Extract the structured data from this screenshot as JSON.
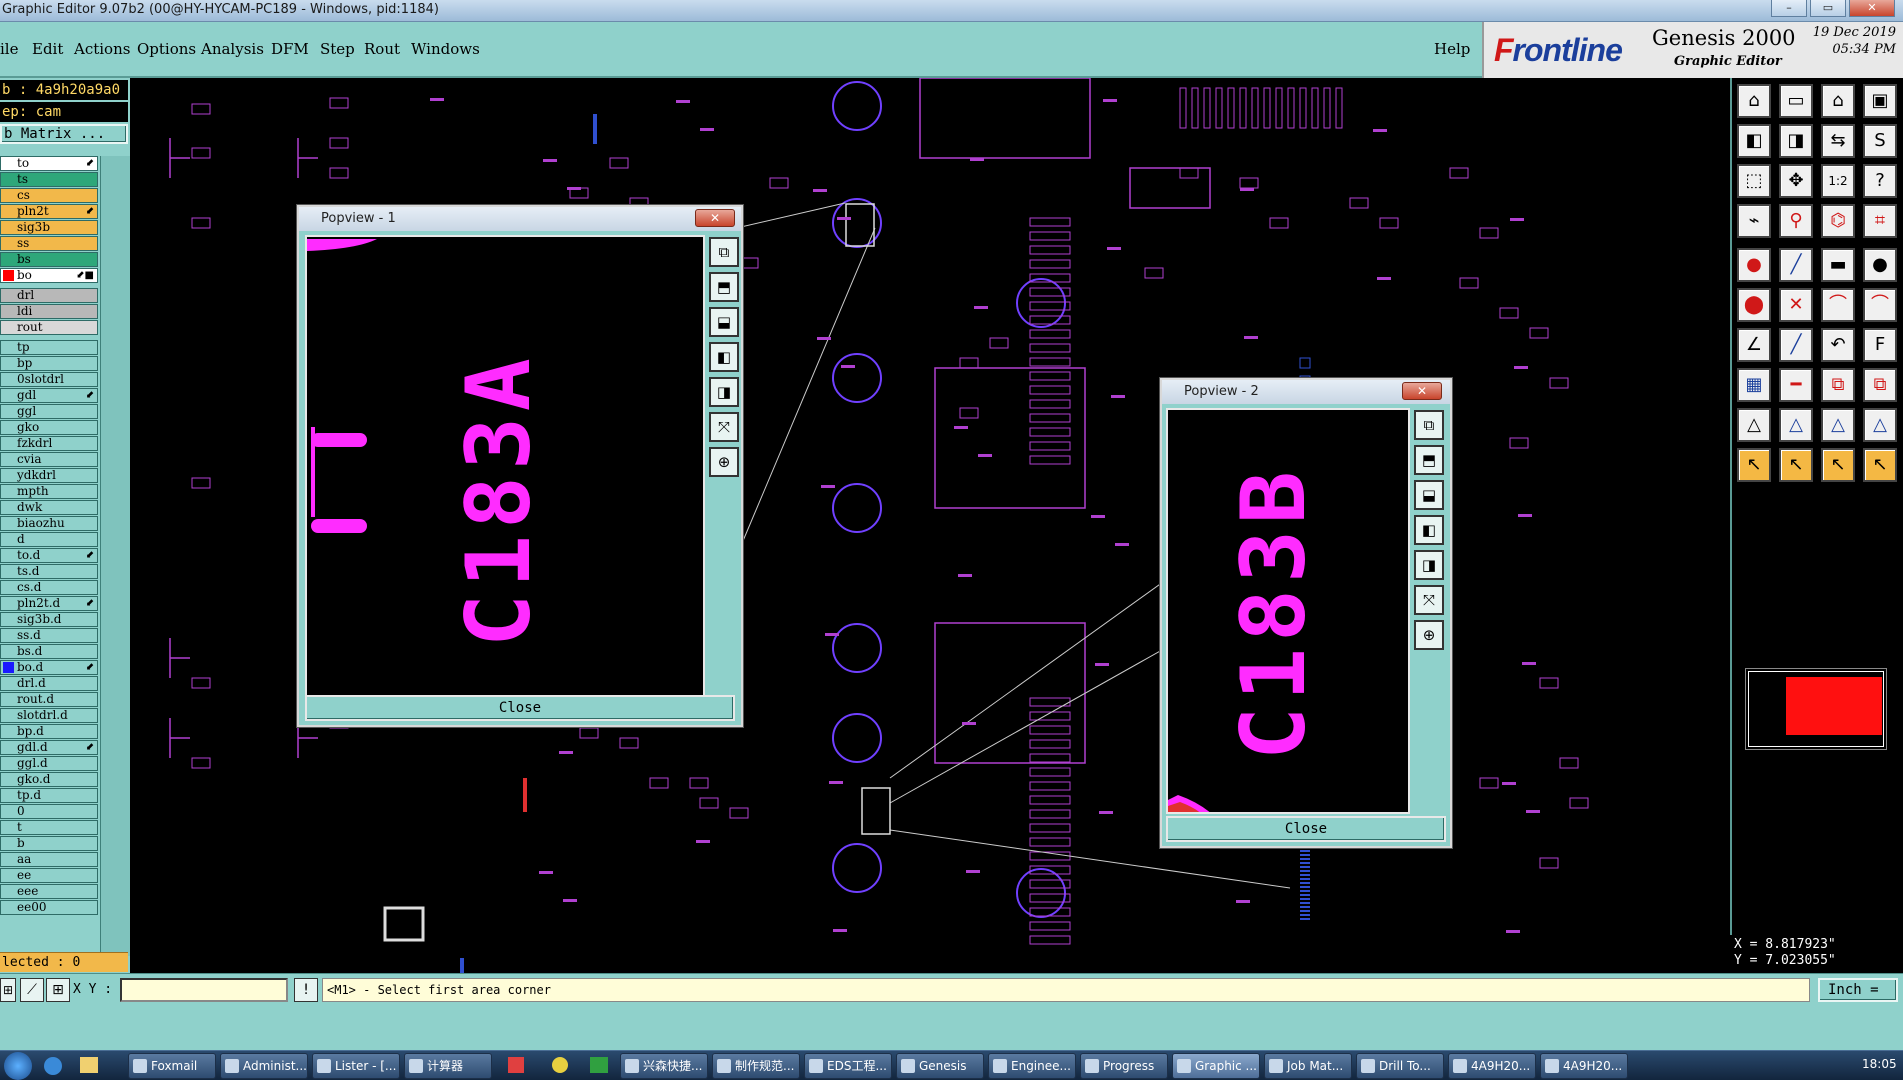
{
  "window": {
    "title": "Graphic Editor 9.07b2 (00@HY-HYCAM-PC189 - Windows, pid:1184)",
    "min_label": "–",
    "max_label": "▭",
    "close_label": "✕"
  },
  "menu": {
    "items": [
      "ile",
      "Edit",
      "Actions",
      "Options",
      "Analysis",
      "DFM",
      "Step",
      "Rout",
      "Windows"
    ],
    "help": "Help"
  },
  "brand": {
    "logo_f": "F",
    "logo_rest": "rontline",
    "product": "Genesis 2000",
    "module": "Graphic Editor",
    "date": "19 Dec 2019",
    "time": "05:34 PM"
  },
  "job": {
    "job_line": "b : 4a9h20a9a0",
    "step_line": "ep: cam",
    "matrix_button": "b Matrix ..."
  },
  "layers": [
    {
      "name": "to",
      "color": "#ffffff",
      "mark": "",
      "arrow": "⬋"
    },
    {
      "name": "ts",
      "color": "#2ea77a",
      "mark": "",
      "arrow": ""
    },
    {
      "name": "cs",
      "color": "#f2b84a",
      "mark": "",
      "arrow": ""
    },
    {
      "name": "pln2t",
      "color": "#f2b84a",
      "mark": "",
      "arrow": "⬋"
    },
    {
      "name": "sig3b",
      "color": "#f2b84a",
      "mark": "",
      "arrow": ""
    },
    {
      "name": "ss",
      "color": "#f2b84a",
      "mark": "",
      "arrow": ""
    },
    {
      "name": "bs",
      "color": "#2ea77a",
      "mark": "",
      "arrow": ""
    },
    {
      "name": "bo",
      "color": "#ffffff",
      "mark": "#ff0000",
      "arrow": "⬋■"
    },
    {
      "name": "drl",
      "color": "#b8b8b8",
      "mark": "",
      "arrow": ""
    },
    {
      "name": "ldi",
      "color": "#b8b8b8",
      "mark": "",
      "arrow": ""
    },
    {
      "name": "rout",
      "color": "#d8d8d8",
      "mark": "",
      "arrow": ""
    },
    {
      "name": "tp",
      "color": "#8fd1cb",
      "mark": "",
      "arrow": ""
    },
    {
      "name": "bp",
      "color": "#8fd1cb",
      "mark": "",
      "arrow": ""
    },
    {
      "name": "0slotdrl",
      "color": "#8fd1cb",
      "mark": "",
      "arrow": ""
    },
    {
      "name": "gdl",
      "color": "#8fd1cb",
      "mark": "",
      "arrow": "⬋"
    },
    {
      "name": "ggl",
      "color": "#8fd1cb",
      "mark": "",
      "arrow": ""
    },
    {
      "name": "gko",
      "color": "#8fd1cb",
      "mark": "",
      "arrow": ""
    },
    {
      "name": "fzkdrl",
      "color": "#8fd1cb",
      "mark": "",
      "arrow": ""
    },
    {
      "name": "cvia",
      "color": "#8fd1cb",
      "mark": "",
      "arrow": ""
    },
    {
      "name": "ydkdrl",
      "color": "#8fd1cb",
      "mark": "",
      "arrow": ""
    },
    {
      "name": "mpth",
      "color": "#8fd1cb",
      "mark": "",
      "arrow": ""
    },
    {
      "name": "dwk",
      "color": "#8fd1cb",
      "mark": "",
      "arrow": ""
    },
    {
      "name": "biaozhu",
      "color": "#8fd1cb",
      "mark": "",
      "arrow": ""
    },
    {
      "name": "d",
      "color": "#8fd1cb",
      "mark": "",
      "arrow": ""
    },
    {
      "name": "to.d",
      "color": "#8fd1cb",
      "mark": "",
      "arrow": "⬋"
    },
    {
      "name": "ts.d",
      "color": "#8fd1cb",
      "mark": "",
      "arrow": ""
    },
    {
      "name": "cs.d",
      "color": "#8fd1cb",
      "mark": "",
      "arrow": ""
    },
    {
      "name": "pln2t.d",
      "color": "#8fd1cb",
      "mark": "",
      "arrow": "⬋"
    },
    {
      "name": "sig3b.d",
      "color": "#8fd1cb",
      "mark": "",
      "arrow": ""
    },
    {
      "name": "ss.d",
      "color": "#8fd1cb",
      "mark": "",
      "arrow": ""
    },
    {
      "name": "bs.d",
      "color": "#8fd1cb",
      "mark": "",
      "arrow": ""
    },
    {
      "name": "bo.d",
      "color": "#8fd1cb",
      "mark": "#1a1aff",
      "arrow": "⬋"
    },
    {
      "name": "drl.d",
      "color": "#8fd1cb",
      "mark": "",
      "arrow": ""
    },
    {
      "name": "rout.d",
      "color": "#8fd1cb",
      "mark": "",
      "arrow": ""
    },
    {
      "name": "slotdrl.d",
      "color": "#8fd1cb",
      "mark": "",
      "arrow": ""
    },
    {
      "name": "bp.d",
      "color": "#8fd1cb",
      "mark": "",
      "arrow": ""
    },
    {
      "name": "gdl.d",
      "color": "#8fd1cb",
      "mark": "",
      "arrow": "⬋"
    },
    {
      "name": "ggl.d",
      "color": "#8fd1cb",
      "mark": "",
      "arrow": ""
    },
    {
      "name": "gko.d",
      "color": "#8fd1cb",
      "mark": "",
      "arrow": ""
    },
    {
      "name": "tp.d",
      "color": "#8fd1cb",
      "mark": "",
      "arrow": ""
    },
    {
      "name": "0",
      "color": "#8fd1cb",
      "mark": "",
      "arrow": ""
    },
    {
      "name": "t",
      "color": "#8fd1cb",
      "mark": "",
      "arrow": ""
    },
    {
      "name": "b",
      "color": "#8fd1cb",
      "mark": "",
      "arrow": ""
    },
    {
      "name": "aa",
      "color": "#8fd1cb",
      "mark": "",
      "arrow": ""
    },
    {
      "name": "ee",
      "color": "#8fd1cb",
      "mark": "",
      "arrow": ""
    },
    {
      "name": "eee",
      "color": "#8fd1cb",
      "mark": "",
      "arrow": ""
    },
    {
      "name": "ee00",
      "color": "#8fd1cb",
      "mark": "",
      "arrow": ""
    }
  ],
  "selected_label": "lected : 0",
  "popview1": {
    "title": "Popview - 1",
    "label": "C183A",
    "close": "Close",
    "close_x": "✕"
  },
  "popview2": {
    "title": "Popview - 2",
    "label": "C183B",
    "close": "Close",
    "close_x": "✕"
  },
  "popup_buttons": [
    "⧉",
    "⬒",
    "⬓",
    "◧",
    "◨",
    "⤧",
    "⊕"
  ],
  "toolbox_icons": [
    "home-icon",
    "window-icon",
    "house-icon",
    "frame-icon",
    "left-icon",
    "right-icon",
    "swap-icon",
    "s-icon",
    "fit-icon",
    "zoom-icon",
    "one-to-one-icon",
    "help-icon",
    "snap-icon",
    "pin-icon",
    "route-icon",
    "net-icon",
    "pad-icon",
    "line-icon",
    "ruler-icon",
    "dot-icon",
    "node-icon",
    "cross-icon",
    "arc-icon",
    "arc2-icon",
    "angle-icon",
    "slash-icon",
    "undo-icon",
    "f-icon",
    "layer-icon",
    "minus-icon",
    "merge-icon",
    "copy-icon",
    "tri1-icon",
    "tri2-icon",
    "tri3-icon",
    "tri4-icon",
    "pointer-icon",
    "pointer2-icon",
    "pointer3-icon",
    "pointer4-icon"
  ],
  "coords": {
    "x": "X = 8.817923\"",
    "y": "Y = 7.023055\""
  },
  "status": {
    "xy_label": "X Y :",
    "xy_value": "",
    "message": "<M1> - Select first area corner",
    "units": "Inch"
  },
  "taskbar": {
    "items": [
      "Foxmail",
      "Administ...",
      "Lister - [...",
      "计算器",
      "兴森快捷...",
      "制作规范...",
      "EDS工程...",
      "Genesis",
      "Enginee...",
      "Progress",
      "Graphic ...",
      "Job Mat...",
      "Drill To...",
      "4A9H20...",
      "4A9H20..."
    ],
    "clock": "18:05"
  },
  "colors": {
    "panel": "#8fd1cb",
    "magenta": "#ff2cff",
    "pcb_purple": "#b040d0",
    "accent_orange": "#f2b84a"
  }
}
